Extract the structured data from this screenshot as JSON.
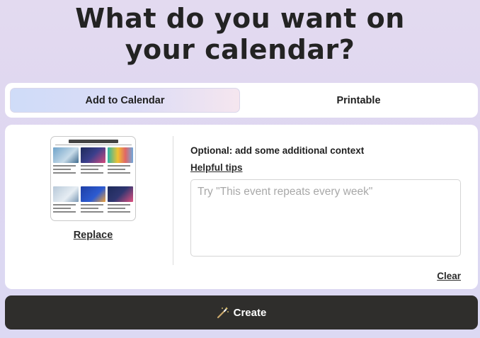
{
  "header": {
    "title_line1": "What do you want on",
    "title_line2": "your calendar?"
  },
  "tabs": [
    {
      "label": "Add to Calendar",
      "active": true
    },
    {
      "label": "Printable",
      "active": false
    }
  ],
  "upload": {
    "replace_label": "Replace"
  },
  "context": {
    "label": "Optional: add some additional context",
    "tips_label": "Helpful tips",
    "placeholder": "Try \"This event repeats every week\"",
    "value": "",
    "clear_label": "Clear"
  },
  "create_button": {
    "label": "Create",
    "icon": "magic-wand-icon"
  },
  "colors": {
    "background": "#e0d9f1",
    "card": "#ffffff",
    "create_button": "#2f2e2c",
    "tab_active_start": "#cfdcf8",
    "tab_active_end": "#f5e6ef"
  }
}
